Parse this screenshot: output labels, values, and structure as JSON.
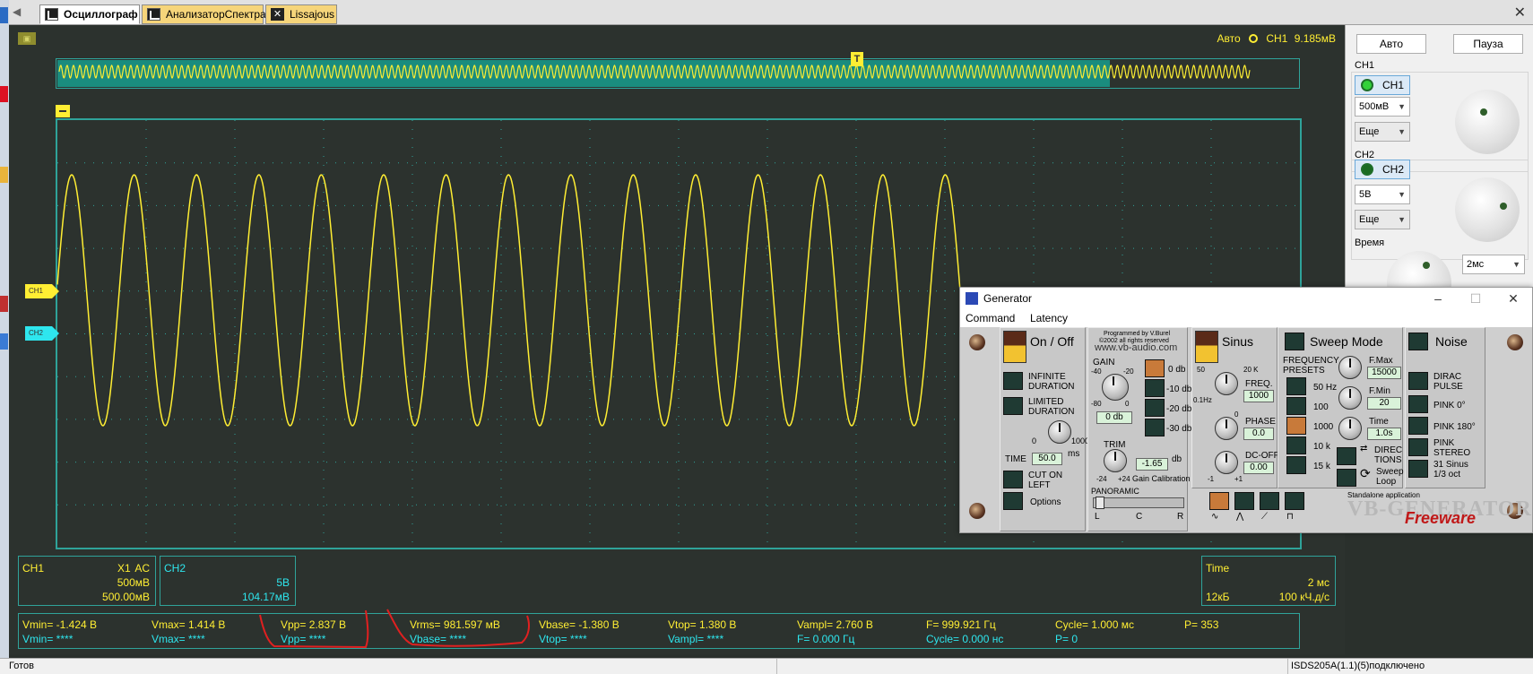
{
  "tabs": [
    {
      "label": "Осциллограф"
    },
    {
      "label": "АнализаторСпектра"
    },
    {
      "label": "Lissajous"
    }
  ],
  "scope": {
    "trigger_mode": "Авто",
    "trigger_channel": "CH1",
    "trigger_level": "9.185мВ",
    "marker_t": "T",
    "ch1_marker": "CH1",
    "ch2_marker": "CH2"
  },
  "ch1_box": {
    "title": "CH1",
    "probe": "X1",
    "coupling": "AC",
    "scale": "500мВ",
    "offset": "500.00мВ"
  },
  "ch2_box": {
    "title": "CH2",
    "scale": "5В",
    "offset": "104.17мВ"
  },
  "time_box": {
    "title": "Time",
    "scale": "2 мс",
    "memory": "12кБ",
    "rate": "100 кЧ.д/с"
  },
  "measurements": {
    "ch1": [
      "Vmin= -1.424 В",
      "Vmax= 1.414 В",
      "Vpp= 2.837 В",
      "Vrms= 981.597 мВ",
      "Vbase= -1.380 В",
      "Vtop= 1.380 В",
      "Vampl= 2.760 В",
      "F= 999.921 Гц",
      "Cycle= 1.000 мс",
      "P= 353"
    ],
    "ch2": [
      "Vmin= ****",
      "Vmax= ****",
      "Vpp= ****",
      "Vbase= ****",
      "Vtop= ****",
      "Vampl= ****",
      "F= 0.000 Гц",
      "Cycle= 0.000 нс",
      "P= 0"
    ]
  },
  "status": {
    "left": "Готов",
    "right": "ISDS205A(1.1)(5)подключено"
  },
  "right_panel": {
    "auto_btn": "Авто",
    "pause_btn": "Пауза",
    "ch1_label": "CH1",
    "ch1_btn": "CH1",
    "ch1_scale": "500мВ",
    "ch1_more": "Еще",
    "ch2_label": "CH2",
    "ch2_btn": "CH2",
    "ch2_scale": "5В",
    "ch2_more": "Еще",
    "time_label": "Время",
    "time_scale": "2мс"
  },
  "generator": {
    "title": "Generator",
    "menu": [
      "Command",
      "Latency"
    ],
    "on_off": "On / Off",
    "infinite": [
      "INFINITE",
      "DURATION"
    ],
    "limited": [
      "LIMITED",
      "DURATION"
    ],
    "time_label": "TIME",
    "time_value": "50.0",
    "time_unit": "ms",
    "time_min": "0",
    "time_max": "1000",
    "cut_on": [
      "CUT ON",
      "LEFT"
    ],
    "options": "Options",
    "credit1": "Programmed by V.Burel",
    "credit2": "©2002 all rights reserved",
    "website": "www.vb-audio.com",
    "gain_label": "GAIN",
    "gain_marks": [
      "-40",
      "-20",
      "-80",
      "0"
    ],
    "gain_value": "0 db",
    "db_buttons": [
      "0 db",
      "-10 db",
      "-20 db",
      "-30 db"
    ],
    "trim_label": "TRIM",
    "trim_min": "-24",
    "trim_max": "+24",
    "trim_value": "-1.65",
    "trim_unit": "db",
    "gain_calibration": "Gain Calibration",
    "panoramic": "PANORAMIC",
    "pan_l": "L",
    "pan_c": "C",
    "pan_r": "R",
    "sinus": "Sinus",
    "freq_label": "FREQ.",
    "freq_value": "1000",
    "freq_min": "0.1Hz",
    "freq_50": "50",
    "freq_max": "20 K",
    "phase_label": "PHASE",
    "phase_value": "0.0",
    "phase_zero": "0",
    "dc_label": "DC-OFF.",
    "dc_value": "0.00",
    "dc_min": "-1",
    "dc_max": "+1",
    "sweep_mode": "Sweep Mode",
    "freq_presets": [
      "FREQUENCY",
      "PRESETS"
    ],
    "presets": [
      "50 Hz",
      "100",
      "1000",
      "10 k",
      "15 k"
    ],
    "fmax_label": "F.Max",
    "fmax_value": "15000",
    "fmin_label": "F.Min",
    "fmin_value": "20",
    "sw_time_label": "Time",
    "sw_time_value": "1.0s",
    "directions": [
      "DIREC",
      "TIONS"
    ],
    "sweep_loop": [
      "Sweep",
      "Loop"
    ],
    "noise": "Noise",
    "noise_items": [
      [
        "DIRAC",
        "PULSE"
      ],
      [
        "PINK 0°"
      ],
      [
        "PINK 180°"
      ],
      [
        "PINK",
        "STEREO"
      ],
      [
        "31 Sinus",
        "1/3 oct"
      ]
    ],
    "standalone": "Standalone application",
    "logo": "VB-GENERATOR",
    "freeware": "Freeware"
  },
  "colors": {
    "ch1": "#ffee33",
    "ch2": "#2ee6ee",
    "grid": "#2fa39a",
    "annotation": "#e02020"
  }
}
